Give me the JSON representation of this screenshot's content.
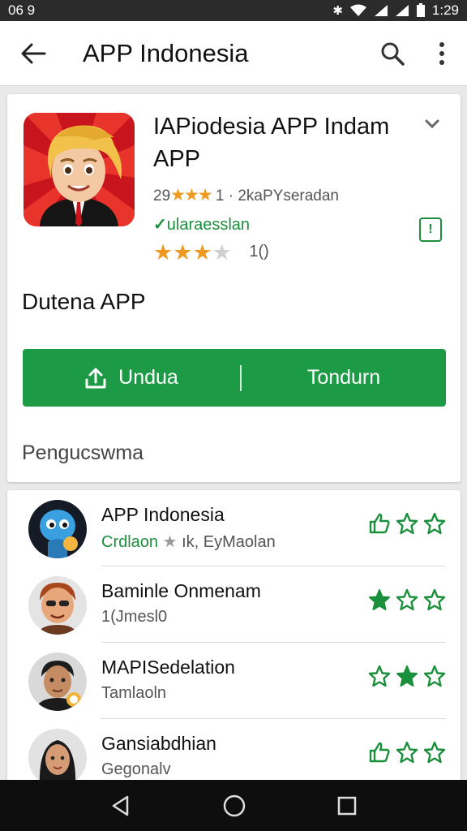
{
  "status_bar": {
    "time_left": "06 9",
    "time_right": "1:29"
  },
  "app_bar": {
    "title": "APP Indonesia"
  },
  "app_card": {
    "name": "IAPiodesia APP Indam APP",
    "rating_prefix": "29",
    "rating_stars": "★★★",
    "rating_suffix": "1 · 2kaPYseradan",
    "verified_text": "ularaesslan",
    "star_count": "1()",
    "section_heading": "Dutena APP",
    "download_label": "Undua",
    "secondary_label": "Tondurn",
    "reviews_heading": "Pengucswma"
  },
  "reviews": [
    {
      "title": "APP Indonesia",
      "sub_green": "Crdlaon",
      "sub_rest": "ık, EyMaolan",
      "actions": [
        "like",
        "star-outline",
        "star-outline"
      ]
    },
    {
      "title": "Baminle Onmenam",
      "sub_green": "",
      "sub_rest": "1(Jmesl0",
      "actions": [
        "star-filled",
        "star-outline",
        "star-outline"
      ]
    },
    {
      "title": "MAPISedelation",
      "sub_green": "",
      "sub_rest": "Tamlaoln",
      "actions": [
        "star-outline",
        "star-filled",
        "star-outline"
      ]
    },
    {
      "title": "Gansiabdhian",
      "sub_green": "",
      "sub_rest": "Gegonalv",
      "actions": [
        "like",
        "star-outline",
        "star-outline"
      ]
    }
  ],
  "colors": {
    "accent_green": "#1c9a46",
    "star_orange": "#ee9a20",
    "status_bar": "#2b2b2b"
  }
}
